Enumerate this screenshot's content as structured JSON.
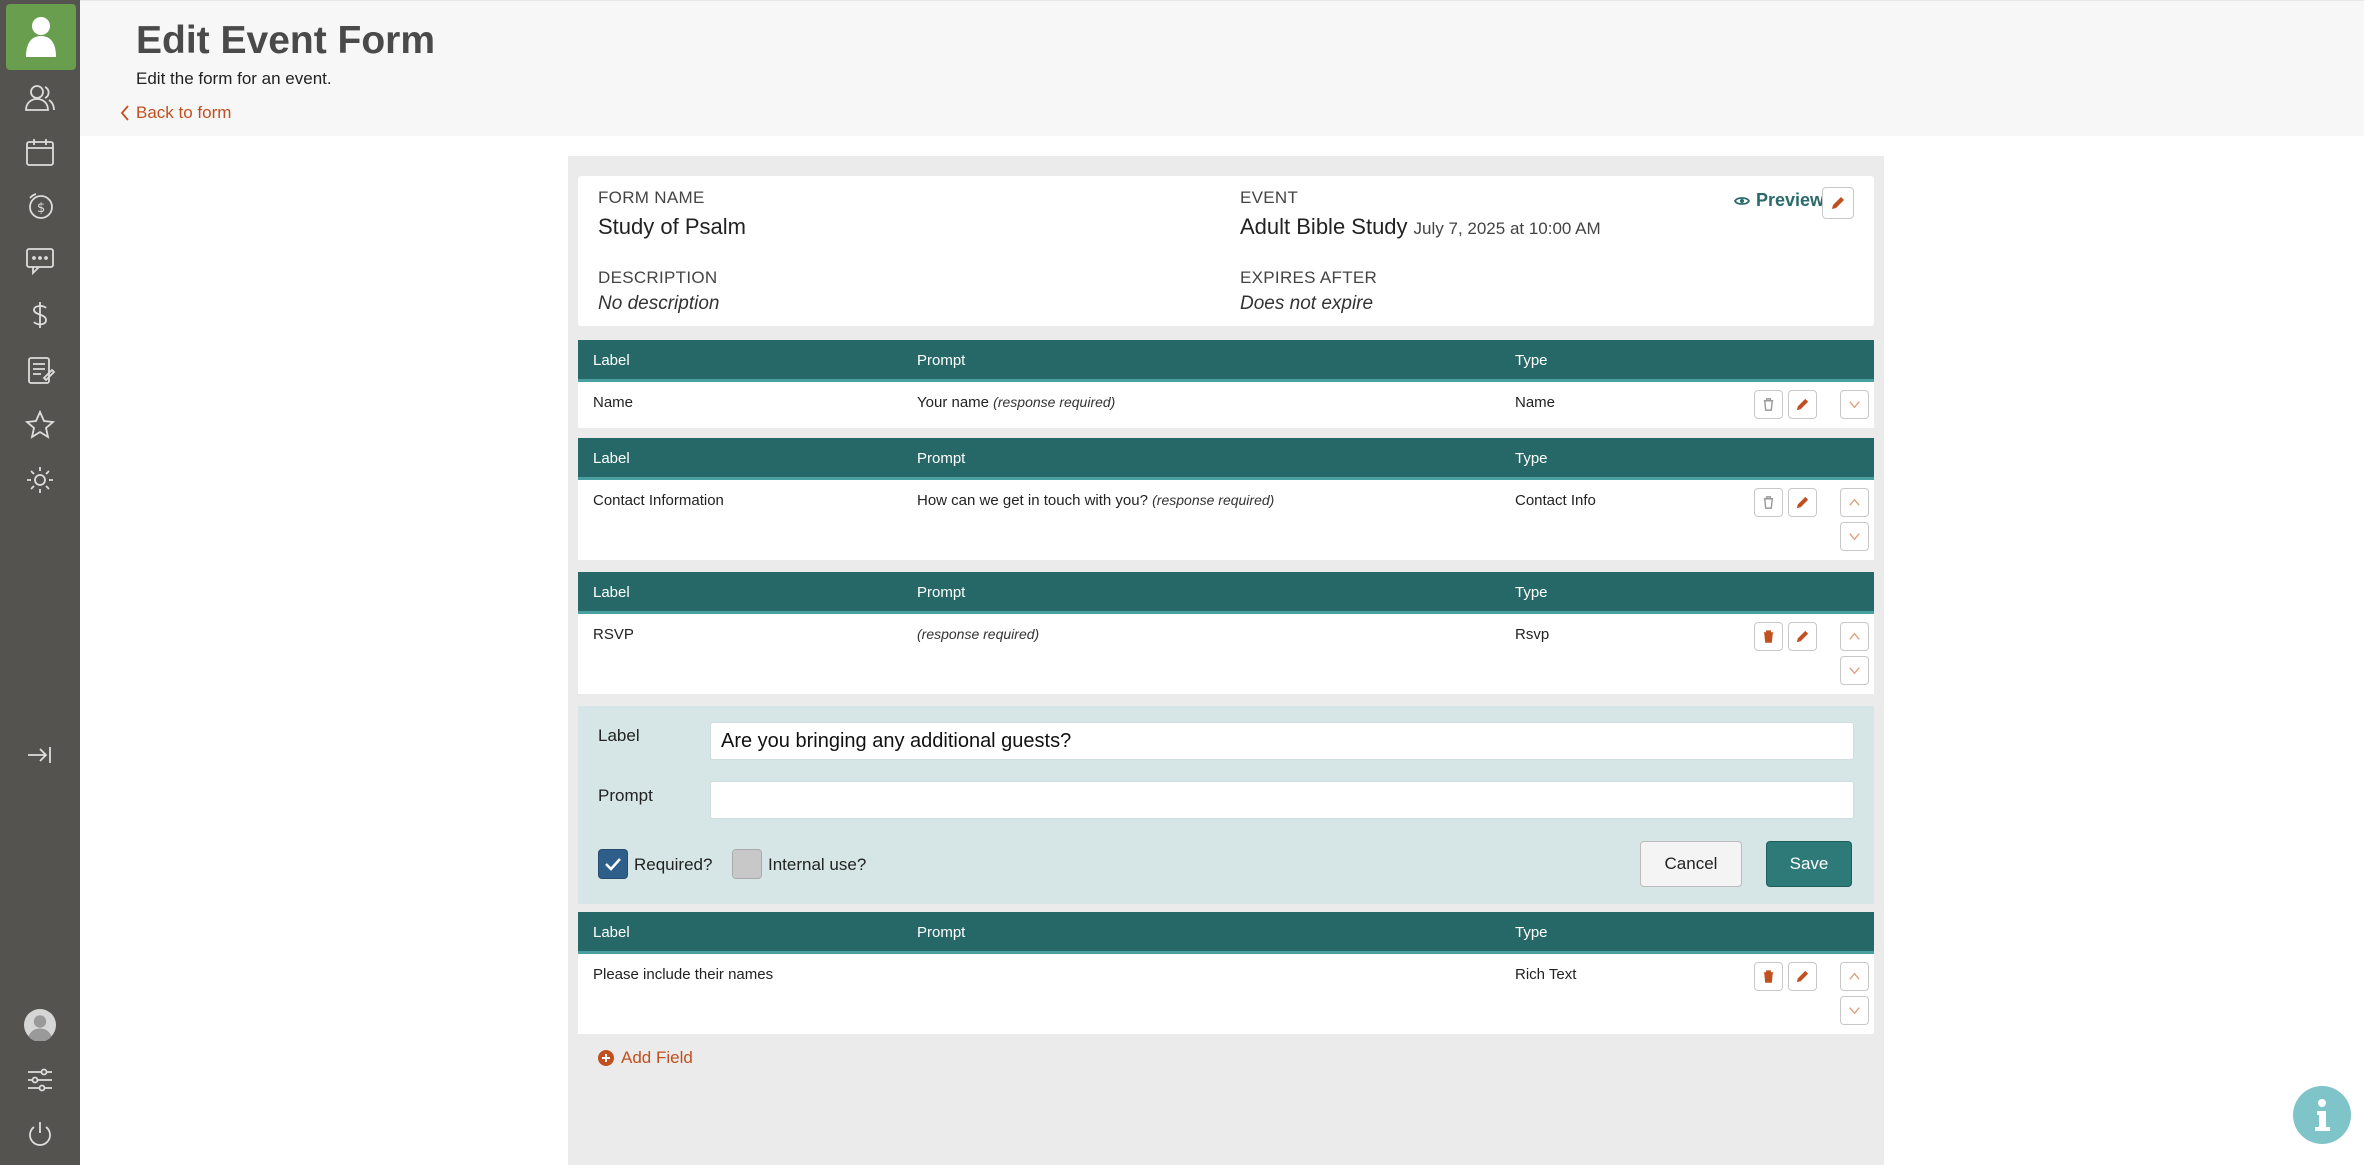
{
  "header": {
    "title": "Edit Event Form",
    "subtitle": "Edit the form for an event.",
    "back_label": "Back to form"
  },
  "sidebar": {
    "items": [
      {
        "icon": "people-icon"
      },
      {
        "icon": "calendar-icon"
      },
      {
        "icon": "giving-icon"
      },
      {
        "icon": "chat-icon"
      },
      {
        "icon": "dollar-icon"
      },
      {
        "icon": "forms-icon"
      },
      {
        "icon": "star-icon"
      },
      {
        "icon": "gear-icon"
      }
    ]
  },
  "form_info": {
    "form_name_label": "FORM NAME",
    "form_name": "Study of Psalm",
    "event_label": "EVENT",
    "event_name": "Adult Bible Study",
    "event_date": "July 7, 2025 at 10:00 AM",
    "description_label": "DESCRIPTION",
    "description": "No description",
    "expires_label": "EXPIRES AFTER",
    "expires": "Does not expire",
    "preview_label": "Preview"
  },
  "columns": {
    "label": "Label",
    "prompt": "Prompt",
    "type": "Type"
  },
  "fields": [
    {
      "label": "Name",
      "prompt": "Your name",
      "required_note": "(response required)",
      "type": "Name"
    },
    {
      "label": "Contact Information",
      "prompt": "How can we get in touch with you?",
      "required_note": "(response required)",
      "type": "Contact Info"
    },
    {
      "label": "RSVP",
      "prompt": "",
      "required_note": "(response required)",
      "type": "Rsvp"
    },
    {
      "label": "Please include their names",
      "prompt": "",
      "required_note": "",
      "type": "Rich Text"
    }
  ],
  "editor": {
    "label_caption": "Label",
    "label_value": "Are you bringing any additional guests?",
    "prompt_caption": "Prompt",
    "prompt_value": "",
    "required_label": "Required?",
    "required_checked": true,
    "internal_label": "Internal use?",
    "internal_checked": false,
    "cancel_label": "Cancel",
    "save_label": "Save"
  },
  "add_field_label": "Add Field",
  "colors": {
    "sidebar": "#55534f",
    "accent_green": "#6a9e4f",
    "table_header": "#266868",
    "link_orange": "#c0501f",
    "editor_bg": "#d6e6e6",
    "save_button": "#2d7a78"
  }
}
